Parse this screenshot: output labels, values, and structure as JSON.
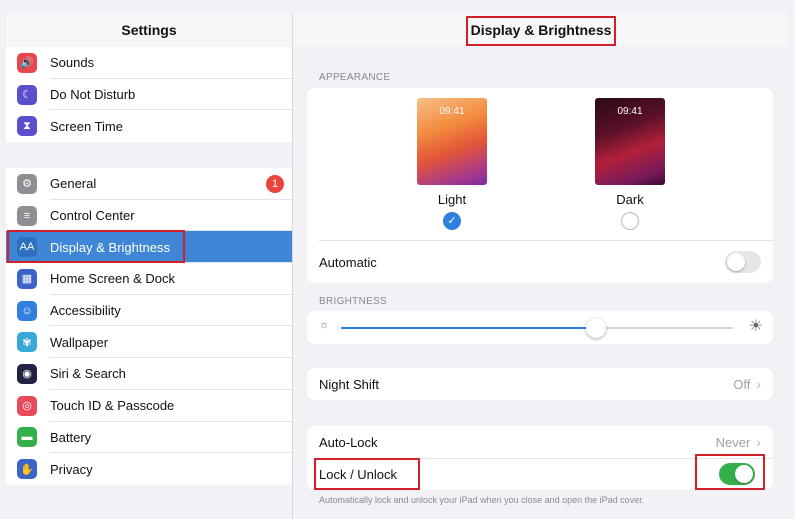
{
  "sidebar": {
    "title": "Settings",
    "group1": [
      {
        "label": "Sounds",
        "icon": "speaker-icon",
        "color": "#e8454f",
        "glyph": "🔊"
      },
      {
        "label": "Do Not Disturb",
        "icon": "moon-icon",
        "color": "#5a4fcf",
        "glyph": "☾"
      },
      {
        "label": "Screen Time",
        "icon": "hourglass-icon",
        "color": "#5a4fcf",
        "glyph": "⧗"
      }
    ],
    "group2": [
      {
        "label": "General",
        "icon": "gear-icon",
        "color": "#8e8e93",
        "glyph": "⚙",
        "badge": "1"
      },
      {
        "label": "Control Center",
        "icon": "switches-icon",
        "color": "#8e8e93",
        "glyph": "≡"
      },
      {
        "label": "Display & Brightness",
        "icon": "text-size-icon",
        "color": "#2f6fc0",
        "glyph": "AA",
        "selected": true
      },
      {
        "label": "Home Screen & Dock",
        "icon": "grid-icon",
        "color": "#3a64c8",
        "glyph": "▦"
      },
      {
        "label": "Accessibility",
        "icon": "accessibility-icon",
        "color": "#2f7fe0",
        "glyph": "☺"
      },
      {
        "label": "Wallpaper",
        "icon": "flower-icon",
        "color": "#38a8d8",
        "glyph": "✾"
      },
      {
        "label": "Siri & Search",
        "icon": "siri-icon",
        "color": "#222244",
        "glyph": "◉"
      },
      {
        "label": "Touch ID & Passcode",
        "icon": "fingerprint-icon",
        "color": "#e84a5a",
        "glyph": "◎"
      },
      {
        "label": "Battery",
        "icon": "battery-icon",
        "color": "#34b04a",
        "glyph": "▬"
      },
      {
        "label": "Privacy",
        "icon": "hand-icon",
        "color": "#3a64c8",
        "glyph": "✋"
      }
    ]
  },
  "main": {
    "title": "Display & Brightness",
    "appearance_header": "APPEARANCE",
    "light": {
      "label": "Light",
      "time": "09:41",
      "selected": true
    },
    "dark": {
      "label": "Dark",
      "time": "09:41",
      "selected": false
    },
    "automatic": {
      "label": "Automatic",
      "on": false
    },
    "brightness_header": "BRIGHTNESS",
    "brightness_level": 0.65,
    "night_shift": {
      "label": "Night Shift",
      "value": "Off"
    },
    "auto_lock": {
      "label": "Auto-Lock",
      "value": "Never"
    },
    "lock_unlock": {
      "label": "Lock / Unlock",
      "on": true
    },
    "footer": "Automatically lock and unlock your iPad when you close and open the iPad cover."
  },
  "colors": {
    "accent": "#3f86d6",
    "toggle_on": "#34b04a",
    "highlight_box": "#d2202a"
  }
}
